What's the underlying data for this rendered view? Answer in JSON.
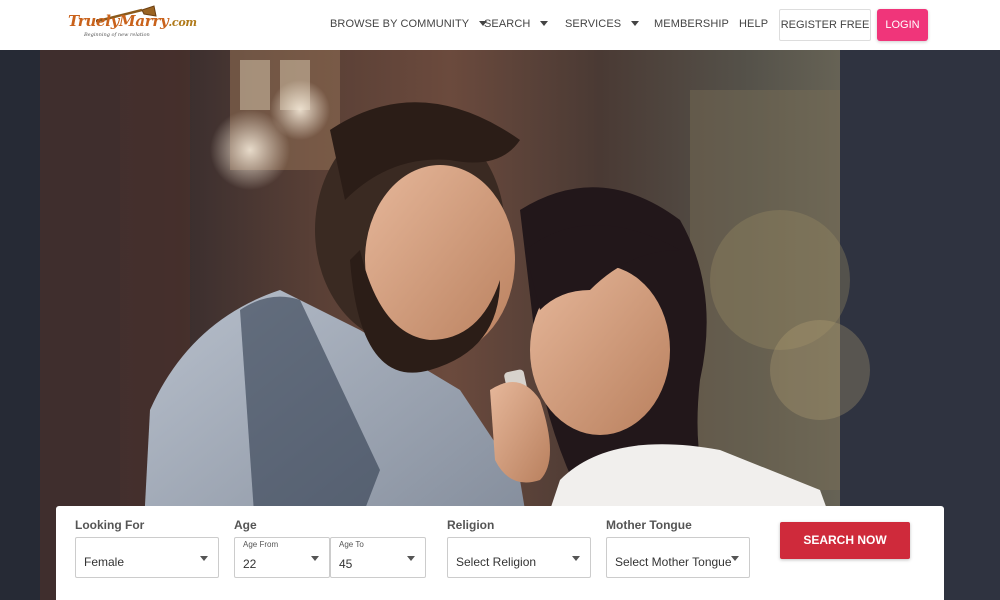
{
  "brand": {
    "logo_text": "TruelyMarry",
    "logo_domain": ".com",
    "tagline": "Beginning of new relation"
  },
  "nav": {
    "items": [
      {
        "label": "BROWSE BY COMMUNITY",
        "has_dropdown": true
      },
      {
        "label": "SEARCH",
        "has_dropdown": true
      },
      {
        "label": "SERVICES",
        "has_dropdown": true
      },
      {
        "label": "MEMBERSHIP",
        "has_dropdown": false
      },
      {
        "label": "HELP",
        "has_dropdown": false
      }
    ],
    "register_label": "REGISTER FREE",
    "login_label": "LOGIN"
  },
  "search": {
    "looking_for": {
      "label": "Looking For",
      "value": "Female"
    },
    "age": {
      "label": "Age",
      "from_label": "Age From",
      "from_value": "22",
      "to_label": "Age To",
      "to_value": "45"
    },
    "religion": {
      "label": "Religion",
      "value": "Select Religion"
    },
    "mother_tongue": {
      "label": "Mother Tongue",
      "value": "Select Mother Tongue"
    },
    "submit_label": "SEARCH NOW"
  },
  "colors": {
    "login_bg": "#f0357a",
    "search_button_bg": "#cf2a3b",
    "logo_text": "#c9621b"
  }
}
